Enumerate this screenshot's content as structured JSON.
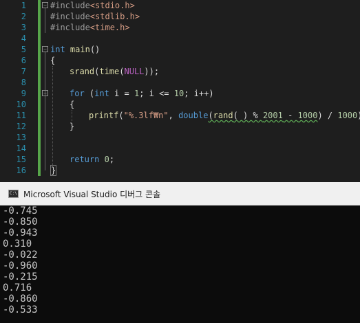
{
  "editor": {
    "line_numbers": [
      "1",
      "2",
      "3",
      "4",
      "5",
      "6",
      "7",
      "8",
      "9",
      "10",
      "11",
      "12",
      "13",
      "14",
      "15",
      "16"
    ],
    "code": {
      "l1_pp": "#include",
      "l1_inc": "<stdio.h>",
      "l2_pp": "#include",
      "l2_inc": "<stdlib.h>",
      "l3_pp": "#include",
      "l3_inc": "<time.h>",
      "l5_kw": "int",
      "l5_fn": "main",
      "l5_rest": "()",
      "l6": "{",
      "l7_fn1": "srand",
      "l7_p1": "(",
      "l7_fn2": "time",
      "l7_p2": "(",
      "l7_mac": "NULL",
      "l7_p3": "));",
      "l9_kw1": "for",
      "l9_p1": " (",
      "l9_kw2": "int",
      "l9_p2": " i = ",
      "l9_n1": "1",
      "l9_p3": "; i <= ",
      "l9_n2": "10",
      "l9_p4": "; i++)",
      "l10": "{",
      "l11_fn": "printf",
      "l11_p1": "(",
      "l11_str": "\"%.3lf₩n\"",
      "l11_p2": ", ",
      "l11_kw": "double",
      "l11_p3": "(",
      "l11_fn2": "rand",
      "l11_p4": "( ) % ",
      "l11_n1": "2001",
      "l11_p5": " - ",
      "l11_n2": "1000",
      "l11_p6": ") / ",
      "l11_n3": "1000",
      "l11_p7": ");",
      "l12": "}",
      "l15_kw": "return",
      "l15_sp": " ",
      "l15_n": "0",
      "l15_semi": ";",
      "l16": "}"
    }
  },
  "console": {
    "icon_text": "C:\\",
    "title": "Microsoft Visual Studio 디버그 콘솔",
    "output": [
      "-0.745",
      "-0.850",
      "-0.943",
      "0.310",
      "-0.022",
      "-0.960",
      "-0.215",
      "0.716",
      "-0.860",
      "-0.533"
    ]
  }
}
